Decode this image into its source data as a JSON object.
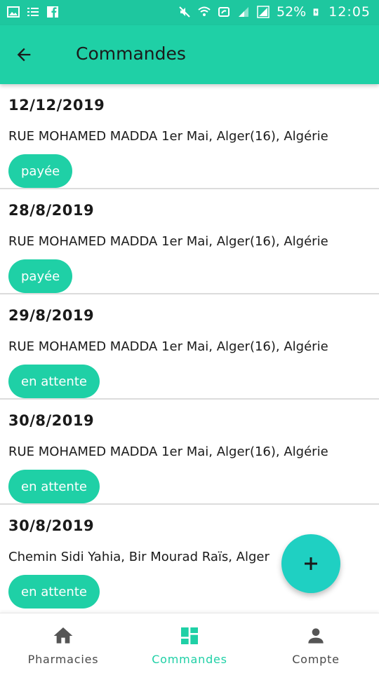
{
  "status_bar": {
    "battery": "52%",
    "time": "12:05"
  },
  "app_bar": {
    "title": "Commandes"
  },
  "orders": [
    {
      "date": "12/12/2019",
      "address": "RUE MOHAMED MADDA 1er Mai, Alger(16), Algérie",
      "status": "payée"
    },
    {
      "date": "28/8/2019",
      "address": "RUE MOHAMED MADDA 1er Mai, Alger(16), Algérie",
      "status": "payée"
    },
    {
      "date": "29/8/2019",
      "address": "RUE MOHAMED MADDA 1er Mai, Alger(16), Algérie",
      "status": "en attente"
    },
    {
      "date": "30/8/2019",
      "address": "RUE MOHAMED MADDA 1er Mai, Alger(16), Algérie",
      "status": "en attente"
    },
    {
      "date": "30/8/2019",
      "address": "Chemin Sidi Yahia, Bir Mourad Raïs, Alger",
      "status": "en attente"
    }
  ],
  "fab": {
    "icon": "plus-icon"
  },
  "bottom_nav": [
    {
      "label": "Pharmacies",
      "icon": "home-icon",
      "active": false
    },
    {
      "label": "Commandes",
      "icon": "dashboard-icon",
      "active": true
    },
    {
      "label": "Compte",
      "icon": "person-icon",
      "active": false
    }
  ],
  "colors": {
    "accent": "#1fd0a6",
    "status_bar": "#1ec79f",
    "fab": "#1fd0c2"
  }
}
